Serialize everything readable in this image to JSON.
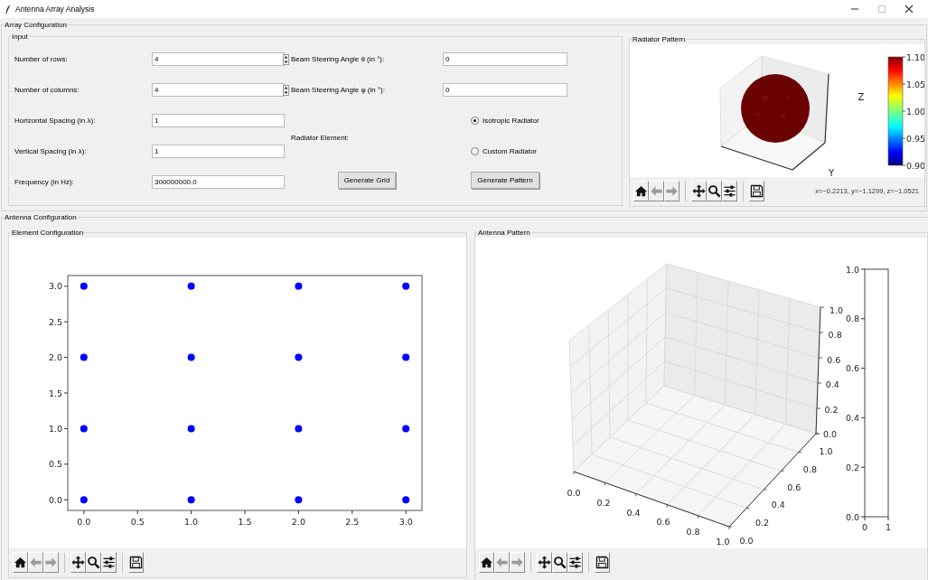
{
  "window": {
    "title": "Antenna Array Analysis",
    "controls": [
      {
        "kind": "minimize",
        "disabled": false
      },
      {
        "kind": "maximize",
        "disabled": true
      },
      {
        "kind": "close",
        "disabled": false
      }
    ]
  },
  "array_configuration": {
    "title": "Array Configuration",
    "input": {
      "title": "Input",
      "fields": [
        {
          "label": "Number of rows:",
          "value": "4",
          "kind": "spinbox"
        },
        {
          "label": "Number of columns:",
          "value": "4",
          "kind": "spinbox"
        },
        {
          "label": "Horizontal Spacing (in λ):",
          "value": "1",
          "kind": "entry"
        },
        {
          "label": "Vertical Spacing (in λ):",
          "value": "1",
          "kind": "entry"
        },
        {
          "label": "Frequency (in Hz):",
          "value": "300000000.0",
          "kind": "entry"
        }
      ],
      "angle_fields": [
        {
          "label": "Beam Steering Angle θ (in °):",
          "value": "0"
        },
        {
          "label": "Beam Steering Angle φ (in °):",
          "value": "0"
        }
      ],
      "radiator_element": {
        "label": "Radiator Element:",
        "options": [
          {
            "label": "Isotropic Radiator",
            "selected": true
          },
          {
            "label": "Custom Radiator",
            "selected": false
          }
        ]
      },
      "buttons": [
        "Generate Grid",
        "Generate Pattern"
      ]
    },
    "radiator_pattern": {
      "title": "Radiator Pattern",
      "z_label": "Z",
      "y_label": "Y",
      "colorbar_ticks": [
        "1.10",
        "1.05",
        "1.00",
        "0.95",
        "0.90"
      ],
      "readout": "x=−0.2213, y=−1.1299, z=−1.0521",
      "toolbar": [
        {
          "kind": "home",
          "disabled": false
        },
        {
          "kind": "back",
          "disabled": true
        },
        {
          "kind": "forward",
          "disabled": true
        },
        {
          "kind": "pan",
          "disabled": false
        },
        {
          "kind": "zoom",
          "disabled": false
        },
        {
          "kind": "configure",
          "disabled": false
        },
        {
          "kind": "save",
          "disabled": false
        }
      ]
    }
  },
  "antenna_configuration": {
    "title": "Antenna Configuration",
    "element_configuration": {
      "title": "Element Configuration",
      "chart_data": {
        "type": "scatter",
        "x": [
          0,
          1,
          2,
          3,
          0,
          1,
          2,
          3,
          0,
          1,
          2,
          3,
          0,
          1,
          2,
          3
        ],
        "series": [
          {
            "color": "#0000ff",
            "values": [
              0,
              0,
              0,
              0,
              1,
              1,
              1,
              1,
              2,
              2,
              2,
              2,
              3,
              3,
              3,
              3
            ]
          }
        ],
        "xlim": [
          -0.15,
          3.15
        ],
        "ylim": [
          -0.15,
          3.15
        ],
        "xticks": [
          {
            "value": 0,
            "label": "0.0"
          },
          {
            "value": 0.5,
            "label": "0.5"
          },
          {
            "value": 1,
            "label": "1.0"
          },
          {
            "value": 1.5,
            "label": "1.5"
          },
          {
            "value": 2,
            "label": "2.0"
          },
          {
            "value": 2.5,
            "label": "2.5"
          },
          {
            "value": 3,
            "label": "3.0"
          }
        ],
        "yticks": [
          {
            "value": 0,
            "label": "0.0"
          },
          {
            "value": 0.5,
            "label": "0.5"
          },
          {
            "value": 1,
            "label": "1.0"
          },
          {
            "value": 1.5,
            "label": "1.5"
          },
          {
            "value": 2,
            "label": "2.0"
          },
          {
            "value": 2.5,
            "label": "2.5"
          },
          {
            "value": 3,
            "label": "3.0"
          }
        ]
      },
      "toolbar": [
        {
          "kind": "home",
          "disabled": false
        },
        {
          "kind": "back",
          "disabled": true
        },
        {
          "kind": "forward",
          "disabled": true
        },
        {
          "kind": "pan",
          "disabled": false
        },
        {
          "kind": "zoom",
          "disabled": false
        },
        {
          "kind": "configure",
          "disabled": false
        },
        {
          "kind": "save",
          "disabled": false
        }
      ]
    },
    "antenna_pattern": {
      "title": "Antenna Pattern",
      "plot_3d": {
        "x_ticks": [
          "0.0",
          "0.2",
          "0.4",
          "0.6",
          "0.8",
          "1.0"
        ],
        "y_ticks": [
          "0.0",
          "0.2",
          "0.4",
          "0.6",
          "0.8",
          "1.0"
        ],
        "z_ticks": [
          "1.0",
          "0.8",
          "0.6",
          "0.4",
          "0.2",
          "0.0"
        ]
      },
      "colorbar": {
        "ticks": [
          "1.0",
          "0.8",
          "0.6",
          "0.4",
          "0.2",
          "0.0"
        ],
        "x_ticks": [
          "0",
          "1"
        ]
      },
      "toolbar": [
        {
          "kind": "home",
          "disabled": false
        },
        {
          "kind": "back",
          "disabled": true
        },
        {
          "kind": "forward",
          "disabled": true
        },
        {
          "kind": "pan",
          "disabled": false
        },
        {
          "kind": "zoom",
          "disabled": false
        },
        {
          "kind": "configure",
          "disabled": false
        },
        {
          "kind": "save",
          "disabled": false
        }
      ]
    }
  }
}
